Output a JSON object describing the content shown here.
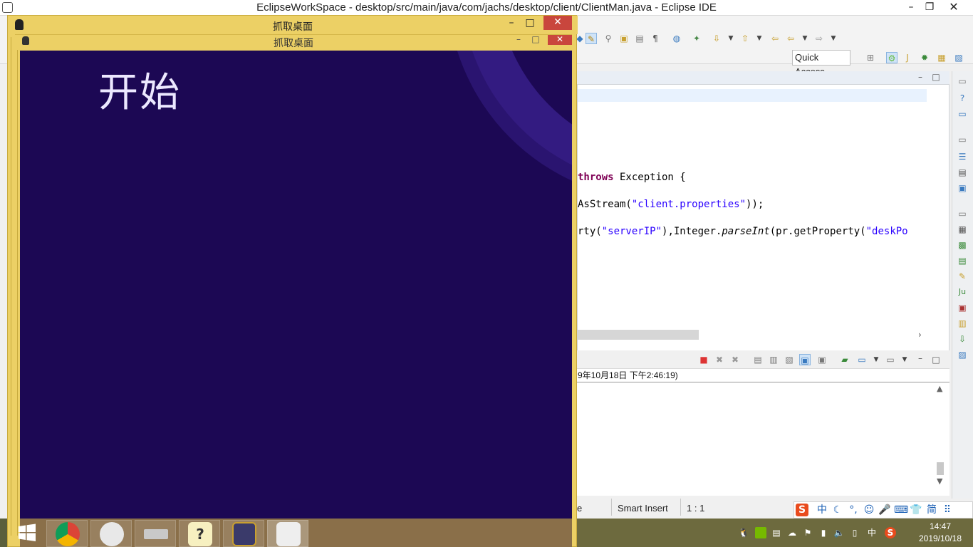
{
  "eclipse": {
    "title": "EclipseWorkSpace - desktop/src/main/java/com/jachs/desktop/client/ClientMan.java - Eclipse IDE",
    "minimize": "–",
    "maximize": "❐",
    "close": "✕",
    "quick_access": "Quick Access",
    "code": {
      "line1_kw": "throws",
      "line1_rest": " Exception {",
      "line2_a": "AsStream(",
      "line2_str": "\"client.properties\"",
      "line2_b": "));",
      "line3_a": "rty(",
      "line3_str1": "\"serverIP\"",
      "line3_b": "),Integer.",
      "line3_it": "parseInt",
      "line3_c": "(pr.getProperty(",
      "line3_str2": "\"deskPo"
    },
    "console_header": "9年10月18日 下午2:46:19)",
    "status": {
      "mode_fragment": "e",
      "insert_mode": "Smart Insert",
      "position": "1 : 1"
    }
  },
  "remote": {
    "outer_title": "抓取桌面",
    "inner_title": "抓取桌面",
    "start_label": "开始",
    "minimize": "–",
    "maximize": "□",
    "close": "✕",
    "taskbar_apps": [
      "start",
      "chrome",
      "tomcat",
      "drive",
      "help",
      "javaee-ide",
      "remote-desktop"
    ]
  },
  "host": {
    "time": "14:47",
    "date": "2019/10/18",
    "ime": [
      "S",
      "中",
      "☾",
      "°,",
      "☺",
      "🎤",
      "⌨",
      "👕",
      "简",
      "⠿"
    ],
    "tray_input": "中"
  },
  "colors": {
    "remote_frame": "#ecd065",
    "remote_background": "#1c0854",
    "close_red": "#c9463d"
  }
}
